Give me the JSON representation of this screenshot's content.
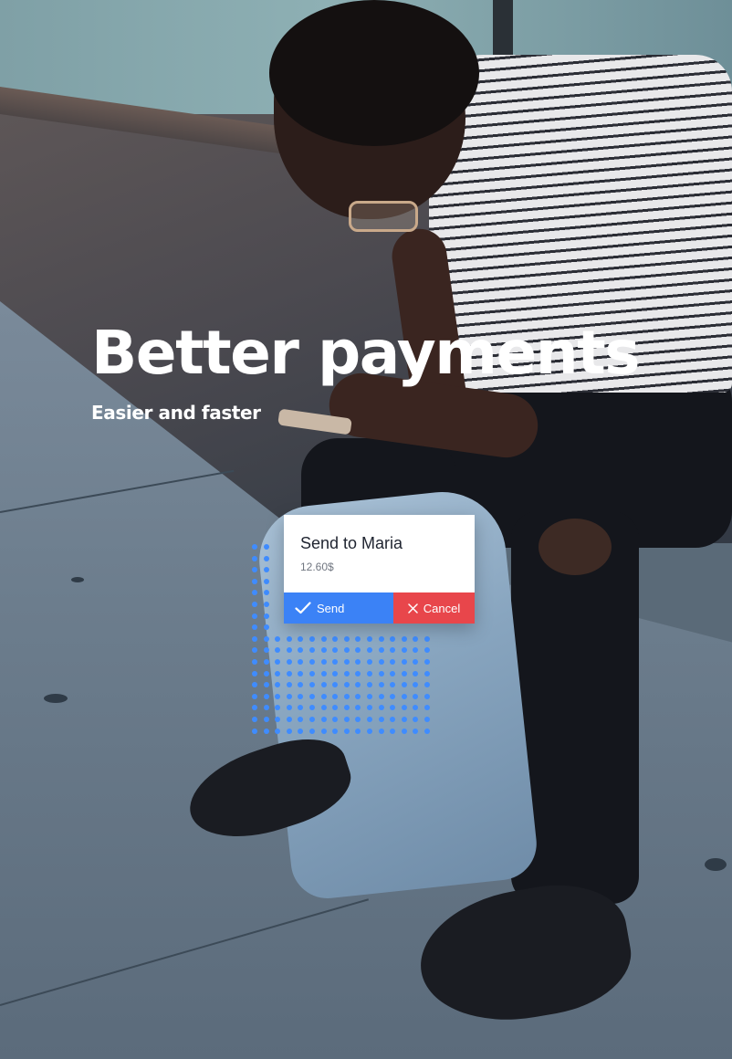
{
  "hero": {
    "headline": "Better payments",
    "subheadline": "Easier and faster"
  },
  "payment_card": {
    "title": "Send to Maria",
    "amount": "12.60$",
    "send_label": "Send",
    "cancel_label": "Cancel",
    "send_icon": "check-icon",
    "cancel_icon": "close-icon"
  },
  "colors": {
    "send": "#3b82f6",
    "cancel": "#e8464b",
    "dots": "#3f8cff",
    "headline": "#ffffff"
  }
}
